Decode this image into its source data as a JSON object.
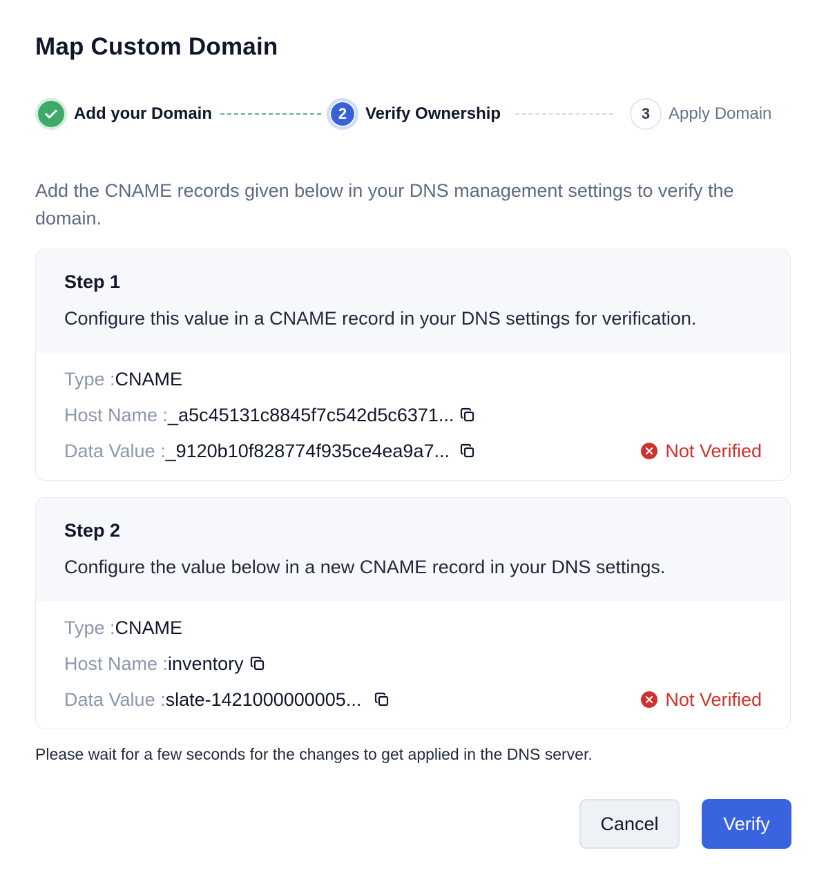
{
  "dialog": {
    "title": "Map Custom Domain",
    "instruction": "Add the CNAME records given below in your DNS management settings to verify the domain.",
    "note": "Please wait for a few seconds for the changes to get applied in the DNS server."
  },
  "stepper": {
    "steps": [
      {
        "number": "1",
        "label": "Add your Domain",
        "state": "completed"
      },
      {
        "number": "2",
        "label": "Verify Ownership",
        "state": "active"
      },
      {
        "number": "3",
        "label": "Apply Domain",
        "state": "pending"
      }
    ]
  },
  "labels": {
    "type": "Type : ",
    "host_name": "Host Name : ",
    "data_value": "Data Value : "
  },
  "cards": [
    {
      "title": "Step 1",
      "description": "Configure this value in a CNAME record in your DNS settings for verification.",
      "type": "CNAME",
      "host_name": "_a5c45131c8845f7c542d5c6371...",
      "data_value": "_9120b10f828774f935ce4ea9a7...",
      "status": "Not Verified"
    },
    {
      "title": "Step 2",
      "description": "Configure the value below in a new CNAME record in your DNS settings.",
      "type": "CNAME",
      "host_name": "inventory",
      "data_value": "slate-1421000000005...",
      "status": "Not Verified"
    }
  ],
  "buttons": {
    "cancel": "Cancel",
    "verify": "Verify"
  },
  "colors": {
    "primary": "#3a63e0",
    "success": "#3fa96a",
    "error": "#d0312d",
    "muted": "#8a97ab"
  },
  "icons": {
    "step_complete": "check-icon",
    "copy": "copy-icon",
    "status": "x-circle-icon"
  }
}
